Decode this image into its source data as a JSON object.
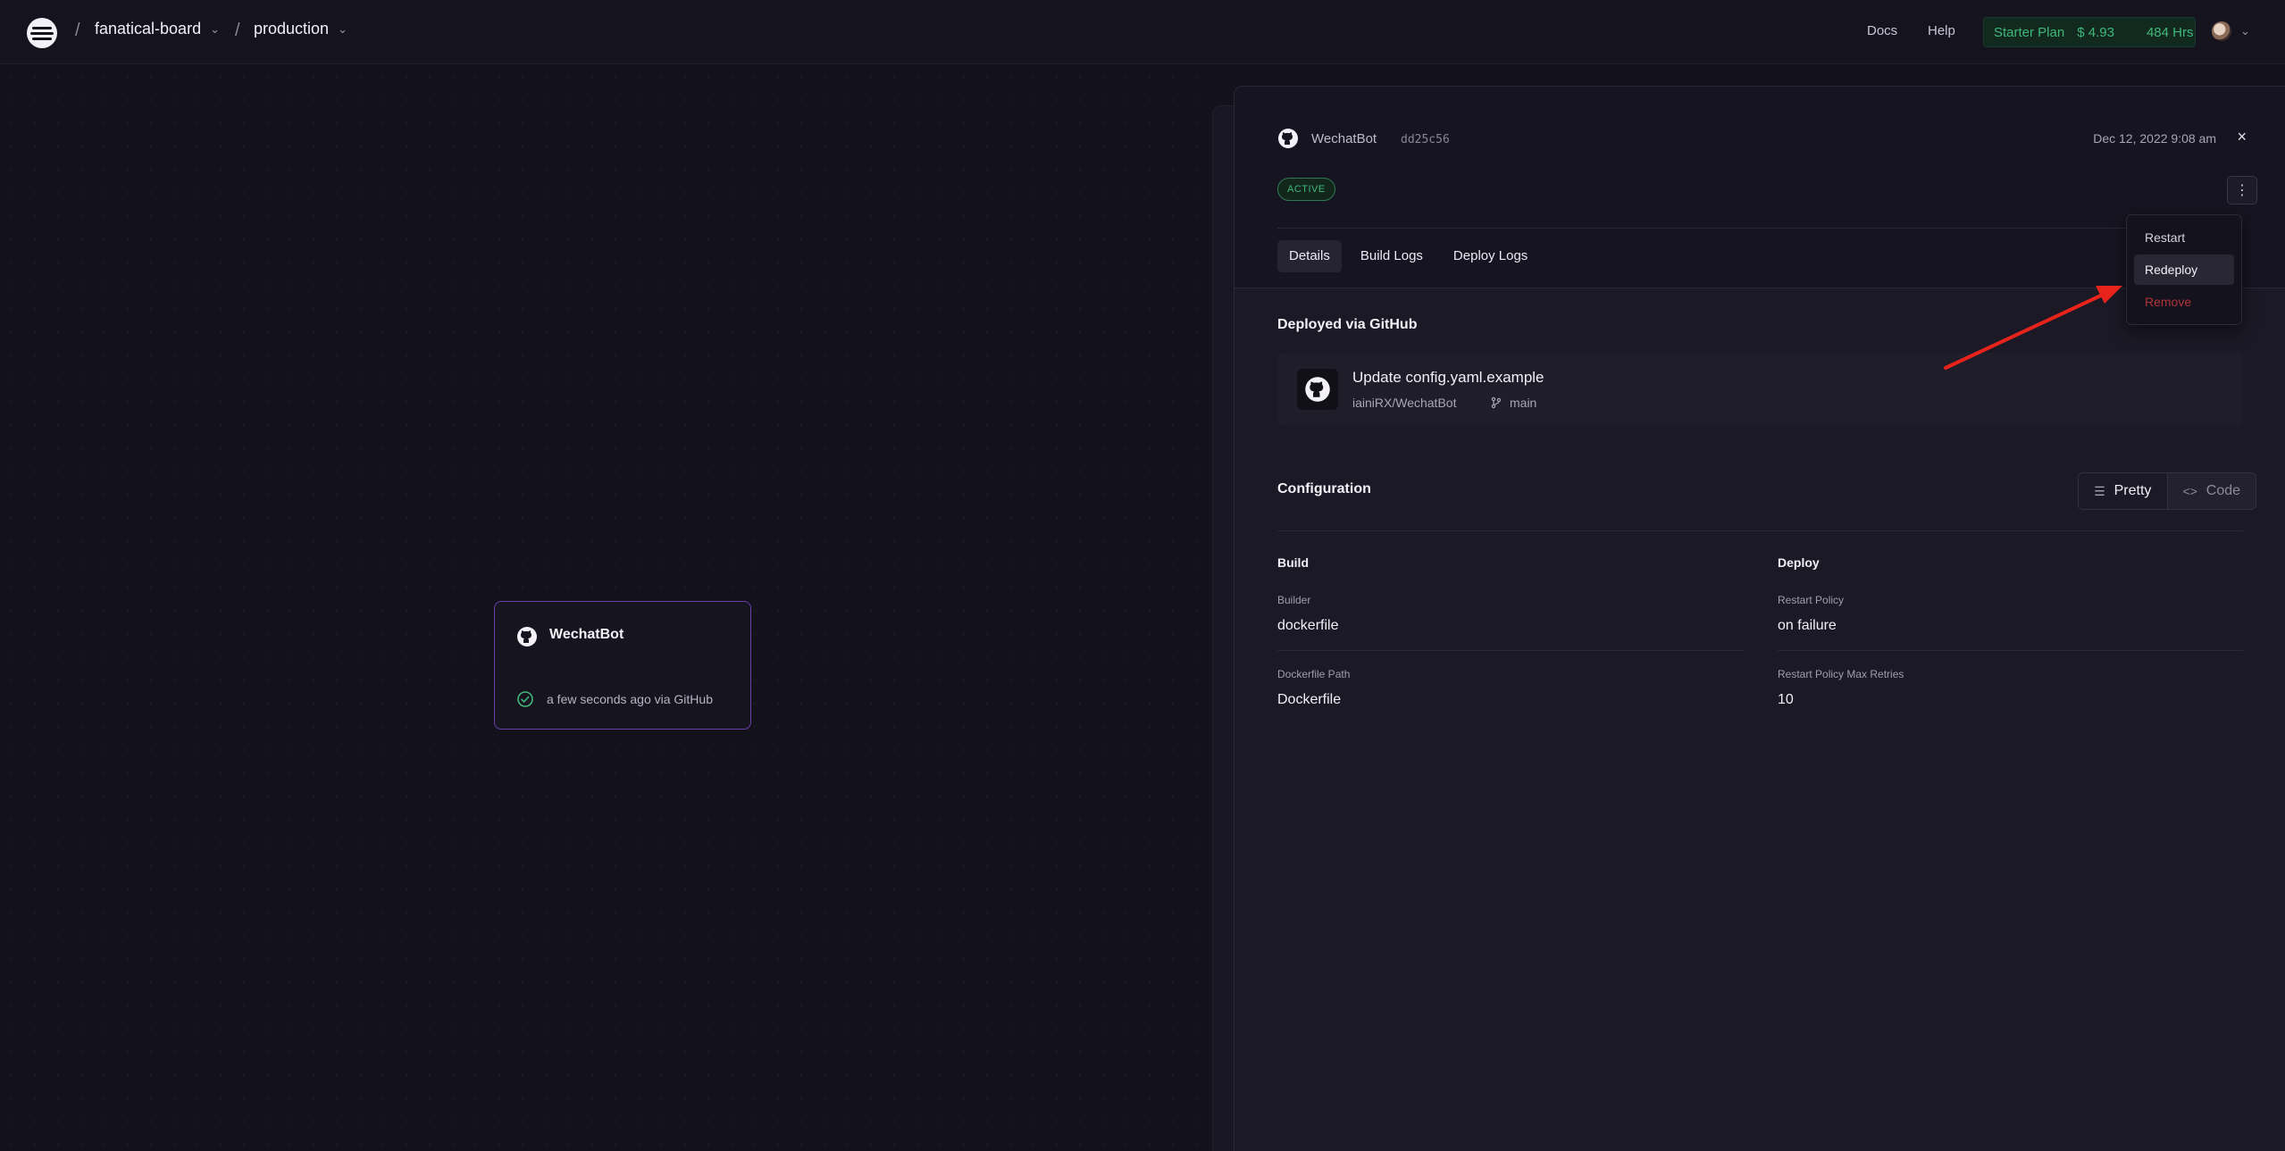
{
  "nav": {
    "project": "fanatical-board",
    "environment": "production",
    "separator": "/",
    "docs": "Docs",
    "help": "Help",
    "plan": {
      "name": "Starter Plan",
      "cost": "$ 4.93",
      "hours": "484 Hrs"
    }
  },
  "canvas": {
    "service": {
      "name": "WechatBot",
      "status": "a few seconds ago via GitHub"
    }
  },
  "panel": {
    "service_name": "WechatBot",
    "commit_hash": "dd25c56",
    "date": "Dec 12, 2022 9:08 am",
    "close": "×",
    "badge": "ACTIVE",
    "kebab": "⋮",
    "tabs": [
      {
        "label": "Details"
      },
      {
        "label": "Build Logs"
      },
      {
        "label": "Deploy Logs"
      }
    ],
    "deployed_title": "Deployed via GitHub",
    "commit": {
      "message": "Update config.yaml.example",
      "repo": "iainiRX/WechatBot",
      "branch": "main"
    },
    "config": {
      "title": "Configuration",
      "pretty_label": "Pretty",
      "code_label": "Code",
      "build": {
        "heading": "Build",
        "builder_label": "Builder",
        "builder_value": "dockerfile",
        "path_label": "Dockerfile Path",
        "path_value": "Dockerfile"
      },
      "deploy": {
        "heading": "Deploy",
        "policy_label": "Restart Policy",
        "policy_value": "on failure",
        "retries_label": "Restart Policy Max Retries",
        "retries_value": "10"
      }
    }
  },
  "menu": {
    "items": [
      {
        "label": "Restart",
        "color": "#d6d2e0"
      },
      {
        "label": "Redeploy",
        "color": "#f3f1f7"
      },
      {
        "label": "Remove",
        "color": "#b0343a"
      }
    ]
  },
  "colors": {
    "accent_green": "#3fb97a",
    "card_border": "#6b3fa8",
    "annotation_arrow": "#e8231b"
  }
}
